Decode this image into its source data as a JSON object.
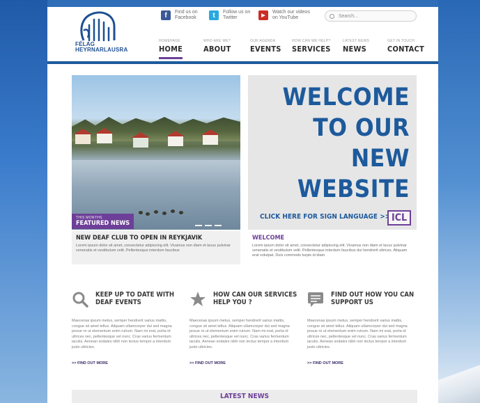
{
  "header": {
    "logo_line1": "FÉLAG",
    "logo_line2": "HEYRNARLAUSRA",
    "social": [
      {
        "icon": "facebook-icon",
        "glyph": "f",
        "color": "#3b5998",
        "line1": "Find us on",
        "line2": "Facebook"
      },
      {
        "icon": "twitter-icon",
        "glyph": "t",
        "color": "#2aa9e0",
        "line1": "Follow us on",
        "line2": "Twitter"
      },
      {
        "icon": "youtube-icon",
        "glyph": "▶",
        "color": "#cc2d26",
        "line1": "Watch our videos",
        "line2": "on YouTube"
      }
    ],
    "search_placeholder": "Search...",
    "nav": [
      {
        "small": "HOMEPAGE",
        "label": "HOME",
        "active": true
      },
      {
        "small": "WHO ARE WE?",
        "label": "ABOUT",
        "active": false
      },
      {
        "small": "OUR AGENDA",
        "label": "EVENTS",
        "active": false
      },
      {
        "small": "HOW CAN WE HELP?",
        "label": "SERVICES",
        "active": false
      },
      {
        "small": "LATEST NEWS",
        "label": "NEWS",
        "active": false
      },
      {
        "small": "GET IN TOUCH",
        "label": "CONTACT",
        "active": false
      }
    ]
  },
  "hero": {
    "featured_small": "THIS MONTHS",
    "featured_big": "FEATURED NEWS",
    "welcome_lines": [
      "WELCOME",
      "TO OUR NEW",
      "WEBSITE"
    ],
    "sign_link": "CLICK HERE FOR SIGN LANGUAGE  >>",
    "icl": "ICL",
    "left_caption_title": "NEW DEAF CLUB TO OPEN IN REYKJAVIK",
    "left_caption_body": "Lorem ipsum dolor sit amet, consectetur adipiscing elit. Vivamus non diam et lacus pulvinar venenatis et vestibulum velit. Pellentesque interdum faucibus",
    "right_caption_title": "WELCOME",
    "right_caption_body": "Lorem ipsum dolor sit amet, consectetur adipiscing elit. Vivamus non diam et lacus pulvinar venenatis et vestibulum velit. Pellentesque interdum faucibus dui hendrerit ultrices. Aliquam erat volutpat. Duis commodo turpis id diam"
  },
  "columns": [
    {
      "icon": "search-icon",
      "title_line1": "KEEP UP TO DATE WITH",
      "title_line2": "DEAF EVENTS",
      "body": "Maecenas ipsum metus, semper hendrerit varius mattis, congue sit amet tellus. Aliquam ullamcorper dui sed magna posue re ut elementum enim rutrum. Nam mi erat, porta id ultrices nec, pellentesque vel nunc. Cras varius fermentum iaculis. Aenean sodales nibh non lectus tempor a interdum justo ultricies.",
      "more": ">>  FIND OUT MORE"
    },
    {
      "icon": "star-icon",
      "title_line1": "HOW CAN OUR SERVICES",
      "title_line2": "HELP YOU ?",
      "body": "Maecenas ipsum metus, semper hendrerit varius mattis, congue sit amet tellus. Aliquam ullamcorper dui sed magna posue re ut elementum enim rutrum. Nam mi erat, porta id ultrices nec, pellentesque vel nunc. Cras varius fermentum iaculis. Aenean sodales nibh non lectus tempor a interdum justo ultricies.",
      "more": ">>  FIND OUT MORE"
    },
    {
      "icon": "chat-icon",
      "title_line1": "FIND OUT HOW YOU CAN",
      "title_line2": "SUPPORT US",
      "body": "Maecenas ipsum metus, semper hendrerit varius mattis, congue sit amet tellus. Aliquam ullamcorper dui sed magna posue re ut elementum enim rutrum. Nam mi erat, porta id ultrices nec, pellentesque vel nunc. Cras varius fermentum iaculis. Aenean sodales nibh non lectus tempor a interdum justo ultricies.",
      "more": ">>  FIND OUT MORE"
    }
  ],
  "latest_news": "LATEST NEWS",
  "colors": {
    "brand_blue": "#1d5a9c",
    "accent_purple": "#6d3f98"
  }
}
